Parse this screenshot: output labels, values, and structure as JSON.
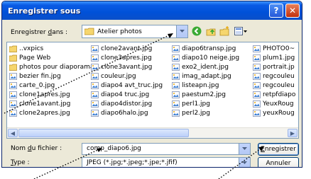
{
  "window": {
    "title": "Enregistrer sous",
    "help_label": "?",
    "close_label": "✕"
  },
  "toolbar": {
    "save_in_prefix": "Enregistrer ",
    "save_in_underlined": "d",
    "save_in_suffix": "ans :",
    "folder": "Atelier photos"
  },
  "files": {
    "col1": [
      {
        "name": "..vxpics",
        "type": "folder"
      },
      {
        "name": "Page Web",
        "type": "folder"
      },
      {
        "name": "photos pour diaporama",
        "type": "folder"
      },
      {
        "name": "bezier fin.jpg",
        "type": "file"
      },
      {
        "name": "carte_0.jpg",
        "type": "file"
      },
      {
        "name": "clone1apres.jpg",
        "type": "file"
      },
      {
        "name": "clone1avant.jpg",
        "type": "file"
      },
      {
        "name": "clone2apres.jpg",
        "type": "file"
      }
    ],
    "col2": [
      {
        "name": "clone2avant.jpg",
        "type": "file"
      },
      {
        "name": "clone3apres.jpg",
        "type": "file"
      },
      {
        "name": "clone3avant.jpg",
        "type": "file"
      },
      {
        "name": "couleur.jpg",
        "type": "file"
      },
      {
        "name": "diapo4 avt_truc.jpg",
        "type": "file"
      },
      {
        "name": "diapo4 truc.jpg",
        "type": "file"
      },
      {
        "name": "diapo4distor.jpg",
        "type": "file"
      },
      {
        "name": "diapo6halo.jpg",
        "type": "file"
      }
    ],
    "col3": [
      {
        "name": "diapo6transp.jpg",
        "type": "file"
      },
      {
        "name": "diapo10 neige.jpg",
        "type": "file"
      },
      {
        "name": "exo2_ident.jpg",
        "type": "file"
      },
      {
        "name": "imag_adapt.jpg",
        "type": "file"
      },
      {
        "name": "listeapn.jpg",
        "type": "file"
      },
      {
        "name": "paestum2.jpg",
        "type": "file"
      },
      {
        "name": "perl1.jpg",
        "type": "file"
      },
      {
        "name": "perl2.jpg",
        "type": "file"
      }
    ],
    "col4": [
      {
        "name": "PHOTO0~",
        "type": "file"
      },
      {
        "name": "plum1.jpg",
        "type": "file"
      },
      {
        "name": "portrait.jp",
        "type": "file"
      },
      {
        "name": "regcouleu",
        "type": "file"
      },
      {
        "name": "regcouleu",
        "type": "file"
      },
      {
        "name": "retpfdiapo",
        "type": "file"
      },
      {
        "name": "YeuxRoug",
        "type": "file"
      },
      {
        "name": "yeuxRoug",
        "type": "file"
      }
    ]
  },
  "form": {
    "filename_label_prefix": "Nom ",
    "filename_label_underlined": "d",
    "filename_label_suffix": "u fichier :",
    "filename_value": "comp_diapo6.jpg",
    "type_label_underlined": "T",
    "type_label_suffix": "ype :",
    "type_value": "JPEG (*.jpg;*.jpeg;*.jpe;*.jfif)",
    "save_label_underlined": "E",
    "save_label_suffix": "nregistrer",
    "cancel_label": "Annuler"
  },
  "colors": {
    "titlebar": "#0A5BE5",
    "dialog_bg": "#ECE9D8",
    "folder_yellow": "#F6D66E"
  }
}
